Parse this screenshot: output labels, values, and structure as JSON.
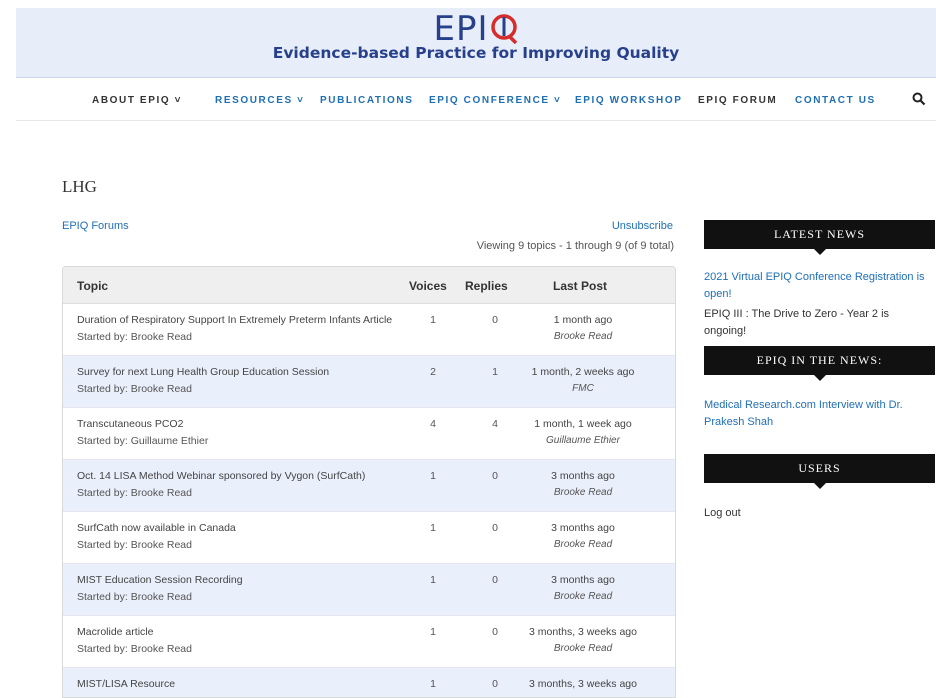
{
  "site": {
    "logo_prefix": "EPI",
    "logo_q": "Q",
    "tagline": "Evidence-based Practice for Improving Quality"
  },
  "nav": {
    "items": [
      {
        "label": "ABOUT EPIQ ˅",
        "color": "dark"
      },
      {
        "label": "RESOURCES ˅",
        "color": "blue"
      },
      {
        "label": "PUBLICATIONS",
        "color": "blue"
      },
      {
        "label": "EPIQ CONFERENCE ˅",
        "color": "blue"
      },
      {
        "label": "EPIQ WORKSHOP",
        "color": "blue"
      },
      {
        "label": "EPIQ FORUM",
        "color": "dark"
      },
      {
        "label": "CONTACT US",
        "color": "blue"
      }
    ],
    "search_icon": "search-icon"
  },
  "page": {
    "title": "LHG",
    "forums_link": "EPIQ Forums",
    "unsubscribe": "Unsubscribe",
    "viewing": "Viewing 9 topics - 1 through 9 (of 9 total)"
  },
  "table": {
    "headers": {
      "topic": "Topic",
      "voices": "Voices",
      "replies": "Replies",
      "last_post": "Last Post"
    },
    "rows": [
      {
        "title": "Duration of Respiratory Support In Extremely Preterm Infants Article",
        "by": "Started by: Brooke Read",
        "voices": "1",
        "replies": "0",
        "last": "1 month ago",
        "last_by": "Brooke Read"
      },
      {
        "title": "Survey for next Lung Health Group Education Session",
        "by": "Started by: Brooke Read",
        "voices": "2",
        "replies": "1",
        "last": "1 month, 2 weeks ago",
        "last_by": "FMC"
      },
      {
        "title": "Transcutaneous PCO2",
        "by": "Started by: Guillaume Ethier",
        "voices": "4",
        "replies": "4",
        "last": "1 month, 1 week ago",
        "last_by": "Guillaume Ethier"
      },
      {
        "title": "Oct. 14 LISA Method Webinar sponsored by Vygon (SurfCath)",
        "by": "Started by: Brooke Read",
        "voices": "1",
        "replies": "0",
        "last": "3 months ago",
        "last_by": "Brooke Read"
      },
      {
        "title": "SurfCath now available in Canada",
        "by": "Started by: Brooke Read",
        "voices": "1",
        "replies": "0",
        "last": "3 months ago",
        "last_by": "Brooke Read"
      },
      {
        "title": "MIST Education Session Recording",
        "by": "Started by: Brooke Read",
        "voices": "1",
        "replies": "0",
        "last": "3 months ago",
        "last_by": "Brooke Read"
      },
      {
        "title": "Macrolide article",
        "by": "Started by: Brooke Read",
        "voices": "1",
        "replies": "0",
        "last": "3 months, 3 weeks ago",
        "last_by": "Brooke Read"
      },
      {
        "title": "MIST/LISA Resource",
        "by": "",
        "voices": "1",
        "replies": "0",
        "last": "3 months, 3 weeks ago",
        "last_by": ""
      }
    ]
  },
  "sidebar": {
    "latest_news_title": "LATEST NEWS",
    "latest_news": [
      "2021 Virtual EPIQ Conference Registration is open!",
      "EPIQ III : The Drive to Zero - Year 2 is ongoing!"
    ],
    "in_the_news_title": "EPIQ IN THE NEWS:",
    "in_the_news": [
      "Medical Research.com Interview with Dr. Prakesh Shah"
    ],
    "users_title": "USERS",
    "logout": "Log out"
  },
  "colors": {
    "brand": "#27408b",
    "link": "#1f6fb5",
    "accent_red": "#d62c2c",
    "banner_bg": "#e8eef9",
    "row_alt": "#e9effb"
  }
}
